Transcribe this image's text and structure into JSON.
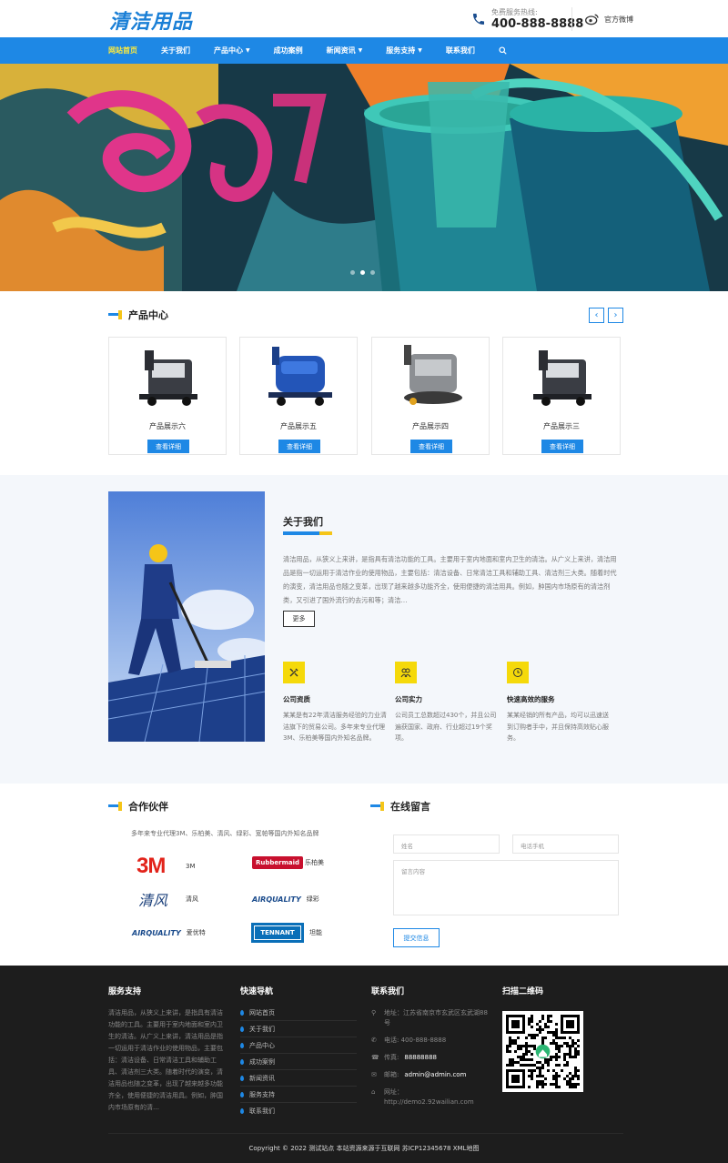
{
  "header": {
    "logo": "清洁用品",
    "hotline_label": "免费服务热线:",
    "hotline_number": "400-888-8888",
    "weibo_label": "官方微博"
  },
  "nav": {
    "items": [
      {
        "label": "网站首页",
        "active": true,
        "dropdown": false
      },
      {
        "label": "关于我们",
        "active": false,
        "dropdown": false
      },
      {
        "label": "产品中心",
        "active": false,
        "dropdown": true
      },
      {
        "label": "成功案例",
        "active": false,
        "dropdown": false
      },
      {
        "label": "新闻资讯",
        "active": false,
        "dropdown": true
      },
      {
        "label": "服务支持",
        "active": false,
        "dropdown": true
      },
      {
        "label": "联系我们",
        "active": false,
        "dropdown": false
      }
    ],
    "search_icon": "search-icon"
  },
  "products": {
    "title": "产品中心",
    "items": [
      {
        "name": "产品展示六",
        "button": "查看详细"
      },
      {
        "name": "产品展示五",
        "button": "查看详细"
      },
      {
        "name": "产品展示四",
        "button": "查看详细"
      },
      {
        "name": "产品展示三",
        "button": "查看详细"
      }
    ]
  },
  "about": {
    "title": "关于我们",
    "text": "清洁用品，从狭义上来讲，是指具有清洁功能的工具。主要用于室内地面和室内卫生的清洁。从广义上来讲，清洁用品是指一切运用于清洁作业的使用物品，主要包括：清洁设备、日常清洁工具和辅助工具、清洁剂三大类。随着时代的演变，清洁用品也随之变革，出现了越来越多功能齐全，使用便捷的清洁用具。例如，肿国内市场原有的清洁剂类，又引进了国外流行的去污和等；清洁…",
    "more": "更多",
    "features": [
      {
        "icon": "tools-icon",
        "title": "公司资质",
        "text": "某某是有22年清洁服务经验的力业清洁旗下的贸易公司。多年来专业代理3M、乐柏美等国内外知名品牌。"
      },
      {
        "icon": "team-icon",
        "title": "公司实力",
        "text": "公司员工总数超过430个，并且公司遍获国家、政府、行业超过19个奖项。"
      },
      {
        "icon": "clock-icon",
        "title": "快速高效的服务",
        "text": "某某经销的所有产品，均可以迅速送到订购者手中，并且保持高效贴心服务。"
      }
    ]
  },
  "partners": {
    "title": "合作伙伴",
    "subtitle": "多年来专业代理3M、乐柏美、清风、绿彩、宽帕等国内外知名品牌",
    "brands": [
      {
        "logo": "3M",
        "name": "3M"
      },
      {
        "logo": "Rubbermaid",
        "name": "乐柏美"
      },
      {
        "logo": "清风",
        "name": "清风"
      },
      {
        "logo": "AIRQUALITY",
        "name": "绿彩"
      },
      {
        "logo": "AIRQUALITY",
        "name": "爱优特"
      },
      {
        "logo": "TENNANT",
        "name": "坦能"
      }
    ]
  },
  "message": {
    "title": "在线留言",
    "name_placeholder": "姓名",
    "phone_placeholder": "电话手机",
    "content_placeholder": "留言内容",
    "submit": "提交信息"
  },
  "footer": {
    "support_title": "服务支持",
    "support_text": "清洁用品，从狭义上来讲，是指具有清洁功能的工具。主要用于室内地面和室内卫生的清洁。从广义上来讲，清洁用品是指一切运用于清洁作业的使用物品，主要包括：清洁设备、日常清洁工具和辅助工具、清洁剂三大类。随着时代的演变，清洁用品也随之变革，出现了越来越多功能齐全，使用便捷的清洁用具。例如，肿国内市场原有的清…",
    "nav_title": "快速导航",
    "nav_items": [
      "网站首页",
      "关于我们",
      "产品中心",
      "成功案例",
      "新闻资讯",
      "服务支持",
      "联系我们"
    ],
    "contact_title": "联系我们",
    "contact": {
      "address": "地址：江苏省南京市玄武区玄武湖88号",
      "phone": "电话: 400-888-8888",
      "fax_label": "传真:",
      "fax": "88888888",
      "email_label": "邮箱:",
      "email": "admin@admin.com",
      "url": "网址：http://demo2.92wailian.com"
    },
    "qr_title": "扫描二维码",
    "copyright": "Copyright © 2022 测试站点 本站资源来源于互联网  苏ICP12345678  XML地图"
  }
}
